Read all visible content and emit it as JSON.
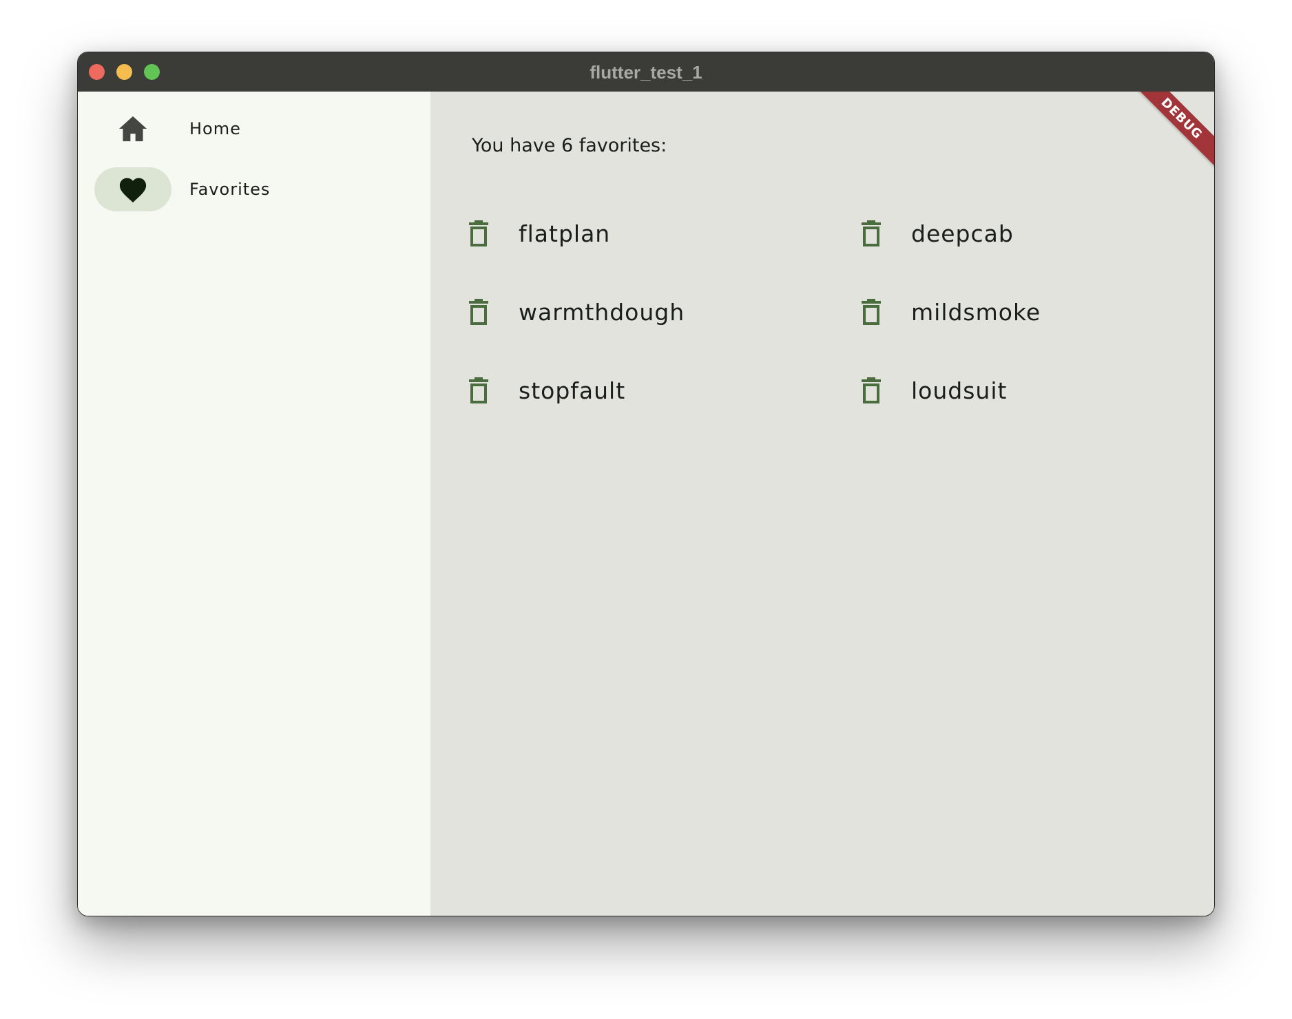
{
  "window": {
    "title": "flutter_test_1",
    "traffic_lights": {
      "close_color": "#ee6a5e",
      "minimize_color": "#f5bd4f",
      "maximize_color": "#61c454"
    }
  },
  "sidebar": {
    "items": [
      {
        "label": "Home",
        "icon": "home-icon",
        "selected": false
      },
      {
        "label": "Favorites",
        "icon": "heart-icon",
        "selected": true
      }
    ]
  },
  "main": {
    "heading": "You have 6 favorites:",
    "favorites": [
      {
        "text": "flatplan",
        "icon": "trash-icon"
      },
      {
        "text": "deepcab",
        "icon": "trash-icon"
      },
      {
        "text": "warmthdough",
        "icon": "trash-icon"
      },
      {
        "text": "mildsmoke",
        "icon": "trash-icon"
      },
      {
        "text": "stopfault",
        "icon": "trash-icon"
      },
      {
        "text": "loudsuit",
        "icon": "trash-icon"
      }
    ],
    "debug_banner": "DEBUG"
  },
  "colors": {
    "sidebar_bg": "#f6f9f1",
    "main_bg": "#e1e3dc",
    "selected_pill": "#dce5d4",
    "accent_green": "#4a6c3f",
    "debug_red": "#a2353a"
  }
}
